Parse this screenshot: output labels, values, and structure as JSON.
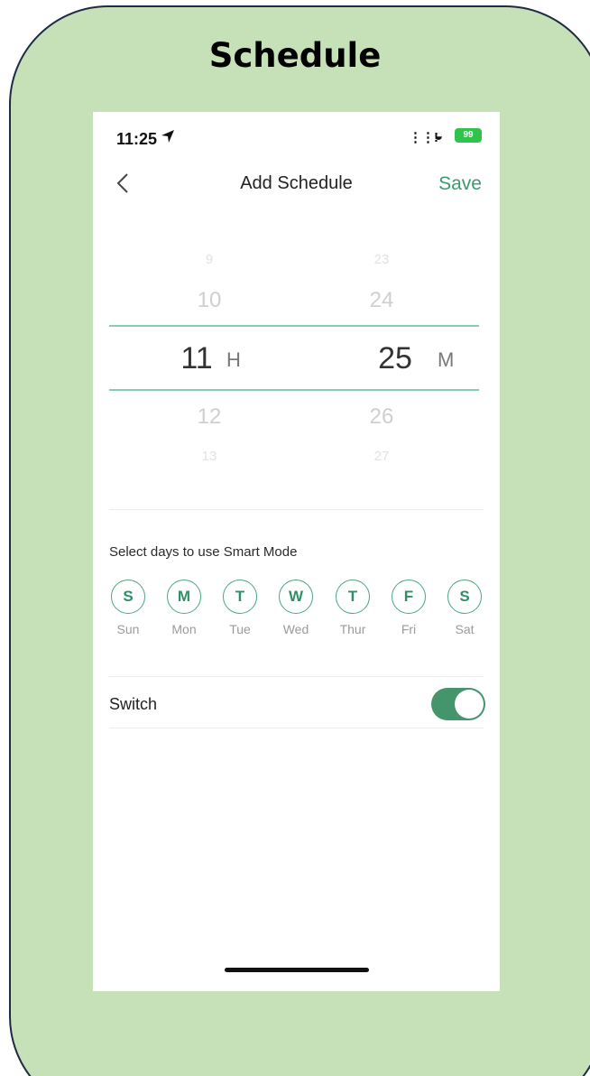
{
  "heading": "Schedule",
  "status_bar": {
    "time": "11:25",
    "battery": "99"
  },
  "nav": {
    "title": "Add Schedule",
    "save_label": "Save"
  },
  "picker": {
    "hours": [
      "9",
      "10",
      "11",
      "12",
      "13"
    ],
    "minutes": [
      "23",
      "24",
      "25",
      "26",
      "27"
    ],
    "selected_hour": "11",
    "selected_minute": "25",
    "hour_unit": "H",
    "minute_unit": "M"
  },
  "days_section": {
    "label": "Select days to use Smart Mode",
    "days": [
      {
        "letter": "S",
        "name": "Sun"
      },
      {
        "letter": "M",
        "name": "Mon"
      },
      {
        "letter": "T",
        "name": "Tue"
      },
      {
        "letter": "W",
        "name": "Wed"
      },
      {
        "letter": "T",
        "name": "Thur"
      },
      {
        "letter": "F",
        "name": "Fri"
      },
      {
        "letter": "S",
        "name": "Sat"
      }
    ]
  },
  "switch_row": {
    "label": "Switch",
    "on": true
  },
  "colors": {
    "accent": "#3c9a6e",
    "toggle_on": "#44946c",
    "frame_bg": "#c6e0b8",
    "frame_border": "#1f2a44",
    "battery": "#2fc34a"
  },
  "icons": {
    "back": "chevron-left-icon",
    "location": "location-arrow-icon",
    "signal": "signal-icon",
    "wifi": "wifi-icon",
    "battery": "battery-icon"
  }
}
